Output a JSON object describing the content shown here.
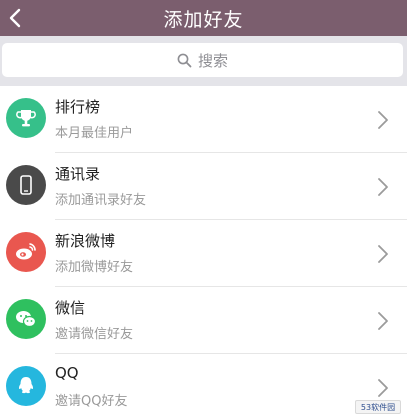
{
  "header": {
    "title": "添加好友"
  },
  "search": {
    "placeholder": "搜索"
  },
  "rows": [
    {
      "name": "排行榜",
      "sub": "本月最佳用户",
      "color": "#36c08a",
      "icon": "trophy-icon"
    },
    {
      "name": "通讯录",
      "sub": "添加通讯录好友",
      "color": "#4a4a4a",
      "icon": "phone-icon"
    },
    {
      "name": "新浪微博",
      "sub": "添加微博好友",
      "color": "#e9574f",
      "icon": "weibo-icon"
    },
    {
      "name": "微信",
      "sub": "邀请微信好友",
      "color": "#2fc05f",
      "icon": "wechat-icon"
    },
    {
      "name": "QQ",
      "sub": "邀请QQ好友",
      "color": "#25b7de",
      "icon": "qq-icon"
    }
  ],
  "watermark": {
    "text": "53软件园"
  },
  "colors": {
    "header": "#7b5e6e",
    "background": "#efeff2"
  }
}
